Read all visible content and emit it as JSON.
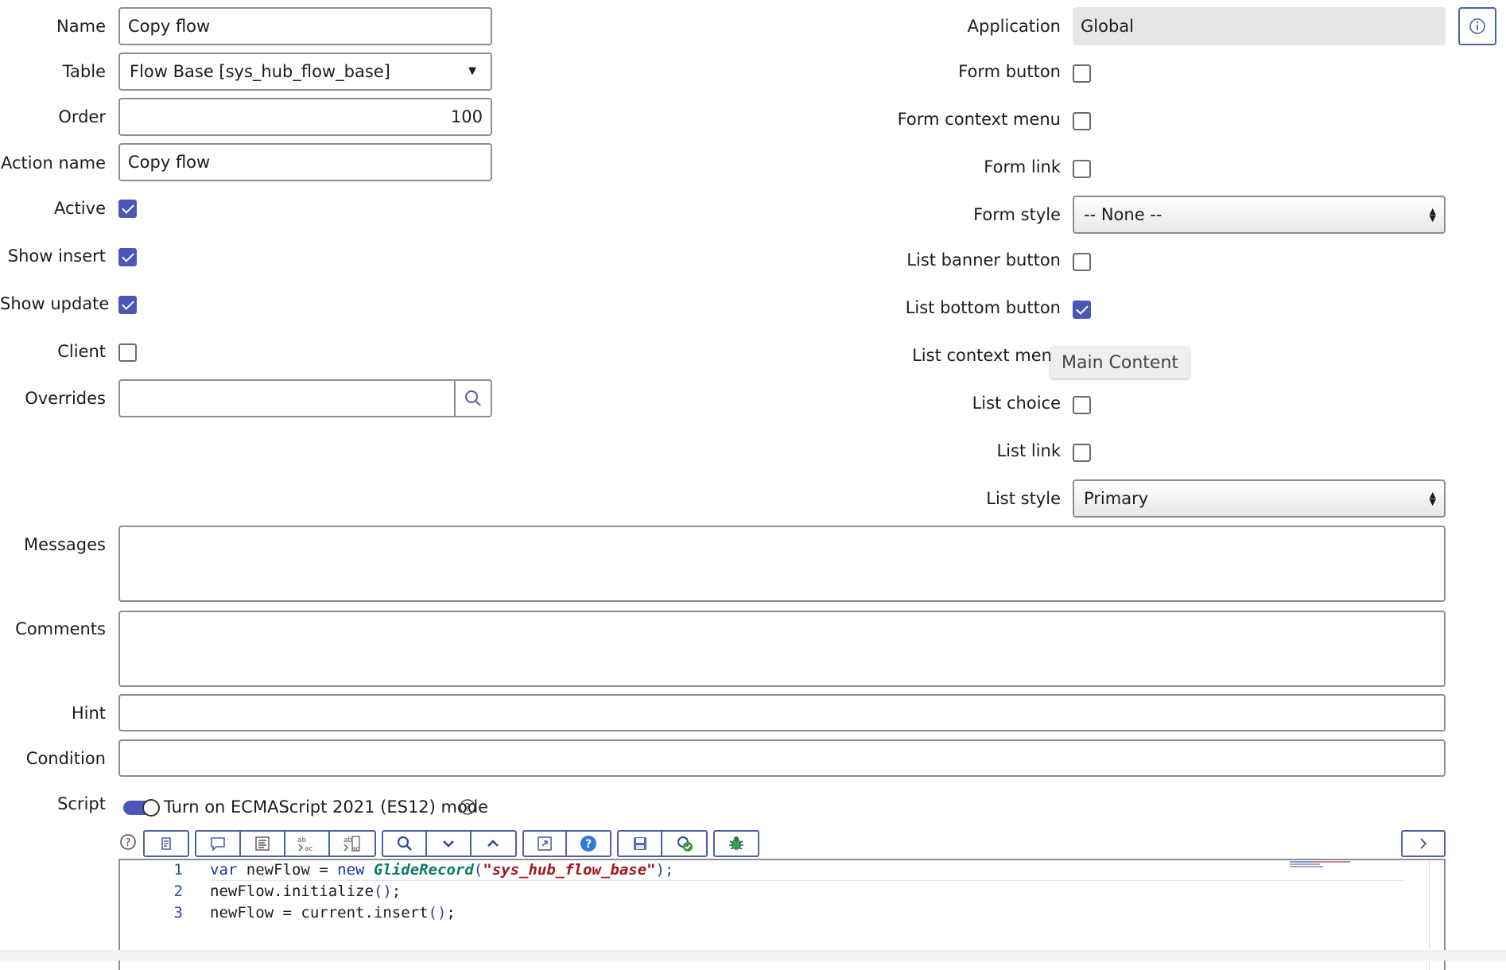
{
  "left_fields": {
    "name_label": "Name",
    "name_value": "Copy flow",
    "table_label": "Table",
    "table_value": "Flow Base [sys_hub_flow_base]",
    "order_label": "Order",
    "order_value": "100",
    "action_name_label": "Action name",
    "action_name_value": "Copy flow",
    "active_label": "Active",
    "active_checked": true,
    "show_insert_label": "Show insert",
    "show_insert_checked": true,
    "show_update_label": "Show update",
    "show_update_checked": true,
    "client_label": "Client",
    "client_checked": false,
    "overrides_label": "Overrides",
    "overrides_value": ""
  },
  "right_fields": {
    "application_label": "Application",
    "application_value": "Global",
    "form_button_label": "Form button",
    "form_context_menu_label": "Form context menu",
    "form_link_label": "Form link",
    "form_style_label": "Form style",
    "form_style_value": "-- None --",
    "list_banner_button_label": "List banner button",
    "list_bottom_button_label": "List bottom button",
    "list_bottom_button_checked": true,
    "list_context_menu_label": "List context men",
    "list_choice_label": "List choice",
    "list_link_label": "List link",
    "list_style_label": "List style",
    "list_style_value": "Primary"
  },
  "tooltip": {
    "text": "Main Content"
  },
  "wide_fields": {
    "messages_label": "Messages",
    "comments_label": "Comments",
    "hint_label": "Hint",
    "condition_label": "Condition",
    "script_label": "Script"
  },
  "script": {
    "es_toggle_label": "Turn on ECMAScript 2021 (ES12) mode",
    "line_numbers": [
      "1",
      "2",
      "3"
    ],
    "line1": {
      "kw1": "var",
      "t1": " newFlow = ",
      "kw2": "new",
      "t2": " ",
      "cls": "GlideRecord",
      "p1": "(",
      "str": "\"sys_hub_flow_base\"",
      "p2": ");"
    },
    "line2": {
      "t1": "newFlow.initialize",
      "p1": "()",
      "t2": ";"
    },
    "line3": {
      "t1": "newFlow = current.insert",
      "p1": "()",
      "t2": ";"
    }
  },
  "icons": {
    "info": "info-icon",
    "search": "search-icon",
    "help": "help-icon"
  },
  "colors": {
    "accent": "#4b56b8",
    "toolbar_border": "#4f5fa6",
    "readonly_bg": "#e6e6e6"
  }
}
